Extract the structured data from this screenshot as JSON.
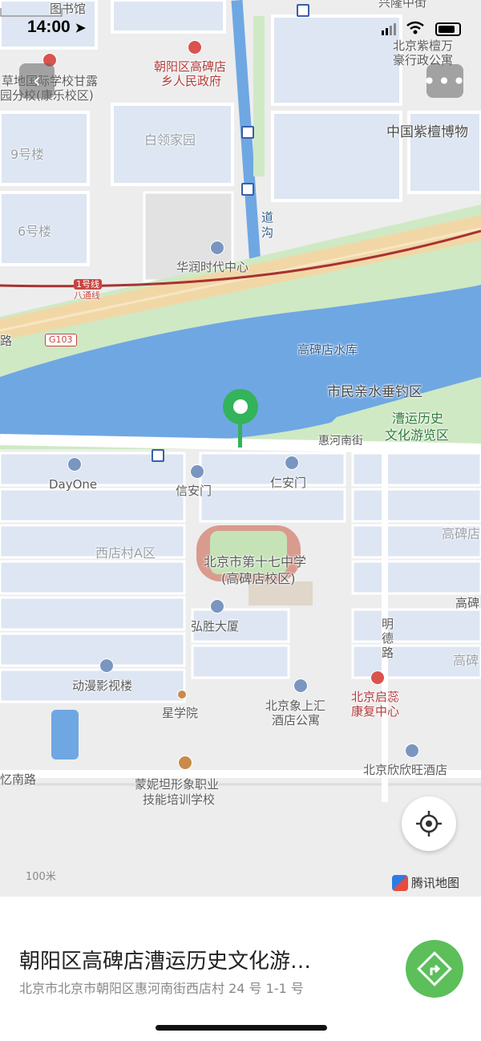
{
  "status_bar": {
    "time": "14:00"
  },
  "map": {
    "labels": {
      "library": "图书馆",
      "road_top": "兴隆中街",
      "school_ganlu": "草地国际学校甘露",
      "school_ganlu_2": "园分校(康乐校区)",
      "gov_1": "朝阳区高碑店",
      "gov_2": "乡人民政府",
      "zitan_apt_1": "北京紫檀万",
      "zitan_apt_2": "豪行政公寓",
      "zitan_museum": "中国紫檀博物",
      "bailing": "白领家园",
      "bld9": "9号楼",
      "bld6": "6号楼",
      "canal_1": "道",
      "canal_2": "沟",
      "huarun": "华润时代中心",
      "subway_1": "1号线",
      "subway_2": "八通线",
      "g103": "G103",
      "road_left": "路",
      "reservoir": "高碑店水库",
      "fishing": "市民亲水垂钓区",
      "canal_park_1": "漕运历史",
      "canal_park_2": "文化游览区",
      "huihe_road": "惠河南街",
      "dayone": "DayOne",
      "xinan": "信安门",
      "renan": "仁安门",
      "gaobeidian_r1": "高碑店",
      "xidian_a": "西店村A区",
      "school17_1": "北京市第十七中学",
      "school17_2": "(高碑店校区)",
      "gaobei_r2": "高碑",
      "gaobei_r3": "高碑",
      "hongsheng": "弘胜大厦",
      "mingde_1": "明",
      "mingde_2": "德",
      "mingde_3": "路",
      "anime": "动漫影视楼",
      "xiangshang_1": "北京象上汇",
      "xiangshang_2": "酒店公寓",
      "qirui_1": "北京启蕊",
      "qirui_2": "康复中心",
      "xingxueyuan": "星学院",
      "xinxinwang": "北京欣欣旺酒店",
      "yinan_road": "忆南路",
      "montessori_1": "蒙妮坦形象职业",
      "montessori_2": "技能培训学校",
      "scale": "100米",
      "brand": "腾讯地图"
    },
    "icons": {
      "back": "chevron-left-icon",
      "more": "more-dots-icon",
      "locate": "locate-crosshair-icon",
      "navigate": "navigation-arrow-icon",
      "pin": "location-pin-icon"
    },
    "colors": {
      "water": "#6fa7e3",
      "green": "#cfe9c4",
      "road_highway": "#f2d7a6",
      "pin": "#33b35a",
      "nav_button": "#5cbf5a"
    }
  },
  "place": {
    "title": "朝阳区高碑店漕运历史文化游…",
    "address": "北京市北京市朝阳区惠河南街西店村 24 号 1-1 号"
  }
}
